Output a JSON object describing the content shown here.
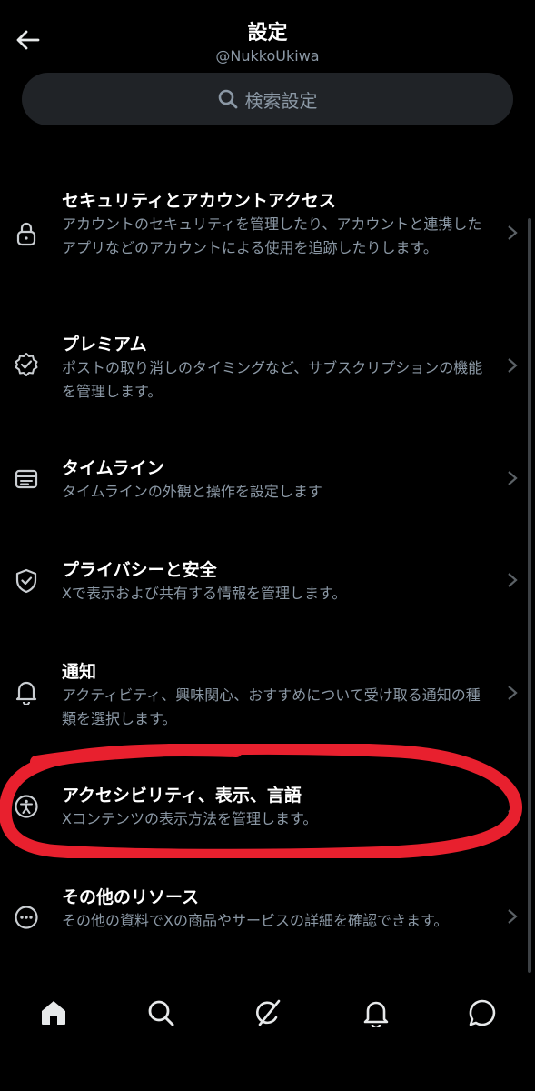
{
  "header": {
    "title": "設定",
    "handle": "@NukkoUkiwa"
  },
  "search": {
    "placeholder": "検索設定"
  },
  "settings_items": [
    {
      "label": "セキュリティとアカウントアクセス",
      "description": "アカウントのセキュリティを管理したり、アカウントと連携したアプリなどのアカウントによる使用を追跡したりします。",
      "icon": "lock-icon"
    },
    {
      "label": "プレミアム",
      "description": "ポストの取り消しのタイミングなど、サブスクリプションの機能を管理します。",
      "icon": "verified-badge-icon"
    },
    {
      "label": "タイムライン",
      "description": "タイムラインの外観と操作を設定します",
      "icon": "timeline-icon"
    },
    {
      "label": "プライバシーと安全",
      "description": "Xで表示および共有する情報を管理します。",
      "icon": "shield-icon"
    },
    {
      "label": "通知",
      "description": "アクティビティ、興味関心、おすすめについて受け取る通知の種類を選択します。",
      "icon": "bell-icon"
    },
    {
      "label": "アクセシビリティ、表示、言語",
      "description": "Xコンテンツの表示方法を管理します。",
      "icon": "accessibility-icon"
    },
    {
      "label": "その他のリソース",
      "description": "その他の資料でXの商品やサービスの詳細を確認できます。",
      "icon": "more-circle-icon"
    }
  ],
  "bottom_nav": [
    {
      "name": "home",
      "icon": "home-icon"
    },
    {
      "name": "search",
      "icon": "search-icon"
    },
    {
      "name": "grok",
      "icon": "grok-icon"
    },
    {
      "name": "notifications",
      "icon": "bell-icon"
    },
    {
      "name": "messages",
      "icon": "message-icon"
    }
  ],
  "colors": {
    "background": "#000000",
    "primary_text": "#e7e9ea",
    "secondary_text": "#8b98a5",
    "search_bg": "#202327",
    "highlight_annotation": "#e8202e"
  }
}
